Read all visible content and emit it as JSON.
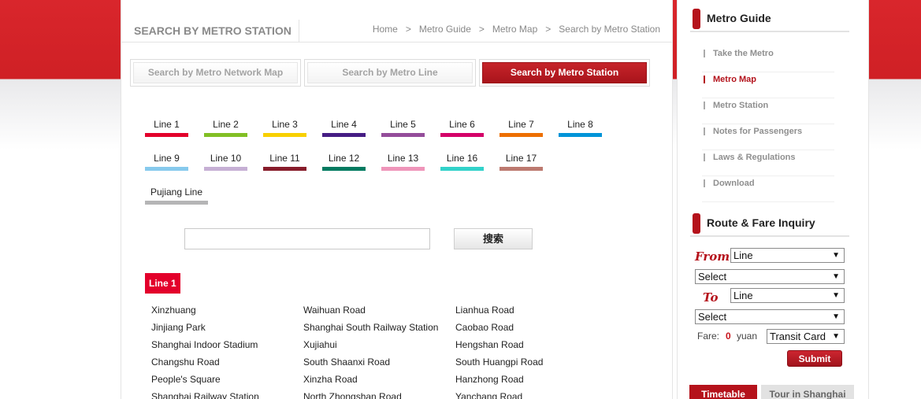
{
  "header": {
    "title": "SEARCH BY METRO STATION",
    "breadcrumb": [
      "Home",
      "Metro Guide",
      "Metro Map",
      "Search by Metro Station"
    ],
    "separator": ">"
  },
  "tabs": [
    {
      "label": "Search by Metro Network Map",
      "active": false
    },
    {
      "label": "Search by Metro Line",
      "active": false
    },
    {
      "label": "Search by Metro Station",
      "active": true
    }
  ],
  "lines": [
    {
      "label": "Line 1",
      "color": "#e3002b"
    },
    {
      "label": "Line 2",
      "color": "#82bf25"
    },
    {
      "label": "Line 3",
      "color": "#f8d000"
    },
    {
      "label": "Line 4",
      "color": "#461d84"
    },
    {
      "label": "Line 5",
      "color": "#944d9a"
    },
    {
      "label": "Line 6",
      "color": "#d40068"
    },
    {
      "label": "Line 7",
      "color": "#ed6f00"
    },
    {
      "label": "Line 8",
      "color": "#0094d8"
    },
    {
      "label": "Line 9",
      "color": "#87caed"
    },
    {
      "label": "Line 10",
      "color": "#c6afd4"
    },
    {
      "label": "Line 11",
      "color": "#871c2b"
    },
    {
      "label": "Line 12",
      "color": "#007a60"
    },
    {
      "label": "Line 13",
      "color": "#ef95ba"
    },
    {
      "label": "Line 16",
      "color": "#32d2ca"
    },
    {
      "label": "Line 17",
      "color": "#bc796f"
    },
    {
      "label": "Pujiang Line",
      "color": "#b5b5b6"
    }
  ],
  "search": {
    "value": "",
    "button_label": "搜索"
  },
  "current_line": {
    "label": "Line 1",
    "color": "#e3002b"
  },
  "stations": [
    [
      "Xinzhuang",
      "Jinjiang Park",
      "Shanghai Indoor Stadium",
      "Changshu Road",
      "People's Square",
      "Shanghai Railway Station"
    ],
    [
      "Waihuan Road",
      "Shanghai South Railway Station",
      "Xujiahui",
      "South Shaanxi Road",
      "Xinzha Road",
      "North Zhongshan Road"
    ],
    [
      "Lianhua Road",
      "Caobao Road",
      "Hengshan Road",
      "South Huangpi Road",
      "Hanzhong Road",
      "Yanchang Road"
    ]
  ],
  "sidebar": {
    "guide_title": "Metro Guide",
    "guide_items": [
      {
        "label": "Take the Metro",
        "active": false
      },
      {
        "label": "Metro Map",
        "active": true
      },
      {
        "label": "Metro Station",
        "active": false
      },
      {
        "label": "Notes for Passengers",
        "active": false
      },
      {
        "label": "Laws & Regulations",
        "active": false
      },
      {
        "label": "Download",
        "active": false
      }
    ],
    "route_title": "Route & Fare Inquiry",
    "from_label": "From",
    "to_label": "To",
    "from_line": "Line",
    "from_station": "Select",
    "to_line": "Line",
    "to_station": "Select",
    "fare_label": "Fare:",
    "fare_value": "0",
    "fare_unit": "yuan",
    "card_type": "Transit Card",
    "submit_label": "Submit",
    "bottom_tabs": [
      {
        "label": "Timetable",
        "active": true
      },
      {
        "label": "Tour in Shanghai",
        "active": false
      }
    ]
  },
  "accent_color": "#b5121b"
}
